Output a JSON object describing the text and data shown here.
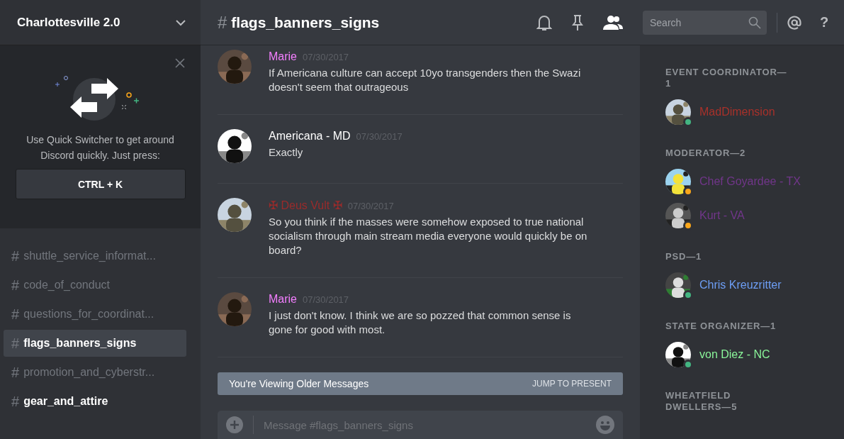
{
  "server": {
    "name": "Charlottesville 2.0"
  },
  "quick_switcher": {
    "text": "Use Quick Switcher to get around Discord quickly. Just press:",
    "shortcut": "CTRL + K"
  },
  "channels": [
    {
      "hash": "#",
      "name": "shuttle_service_informat...",
      "selected": false,
      "unread": false
    },
    {
      "hash": "#",
      "name": "code_of_conduct",
      "selected": false,
      "unread": false
    },
    {
      "hash": "#",
      "name": "questions_for_coordinat...",
      "selected": false,
      "unread": false
    },
    {
      "hash": "#",
      "name": "flags_banners_signs",
      "selected": true,
      "unread": false
    },
    {
      "hash": "#",
      "name": "promotion_and_cyberstr...",
      "selected": false,
      "unread": false
    },
    {
      "hash": "#",
      "name": "gear_and_attire",
      "selected": false,
      "unread": true
    }
  ],
  "header": {
    "hash": "#",
    "channel": "flags_banners_signs",
    "search_placeholder": "Search",
    "help": "?"
  },
  "messages": [
    {
      "author": "Marie",
      "color": "#f47fff",
      "date": "07/30/2017",
      "text": "If Americana culture can accept 10yo transgenders then the Swazi doesn't seem that outrageous"
    },
    {
      "author": "Americana - MD",
      "color": "#ffffff",
      "date": "07/30/2017",
      "text": "Exactly"
    },
    {
      "author": "✠ Deus Vult ✠",
      "color": "#9a2b2b",
      "date": "07/30/2017",
      "text": "So you think if the masses were somehow exposed to true national socialism through main stream media everyone would quickly be on board?"
    },
    {
      "author": "Marie",
      "color": "#f47fff",
      "date": "07/30/2017",
      "text": "I just don't know. I think we are so pozzed that common sense is gone for good with most."
    }
  ],
  "older_banner": {
    "text": "You're Viewing Older Messages",
    "action": "JUMP TO PRESENT"
  },
  "composer": {
    "placeholder": "Message #flags_banners_signs"
  },
  "member_groups": [
    {
      "title": "EVENT COORDINATOR—1",
      "members": [
        {
          "name": "MadDimension",
          "color": "#a8312a",
          "status_dot": {
            "color": "#43b581"
          }
        }
      ]
    },
    {
      "title": "MODERATOR—2",
      "members": [
        {
          "name": "Chef Goyardee - TX",
          "color": "#71368a",
          "status_dot": {
            "color": "#faa61a"
          }
        },
        {
          "name": "Kurt - VA",
          "color": "#71368a",
          "status_dot": {
            "color": "#faa61a"
          }
        }
      ]
    },
    {
      "title": "PSD—1",
      "members": [
        {
          "name": "Chris Kreuzritter",
          "color": "#6d9ef5",
          "status_dot": {
            "color": "#43b581"
          }
        }
      ]
    },
    {
      "title": "STATE ORGANIZER—1",
      "members": [
        {
          "name": "von Diez - NC",
          "color": "#8af59a",
          "status_dot": {
            "color": "#43b581"
          }
        }
      ]
    },
    {
      "title": "WHEATFIELD DWELLERS—5"
    }
  ]
}
